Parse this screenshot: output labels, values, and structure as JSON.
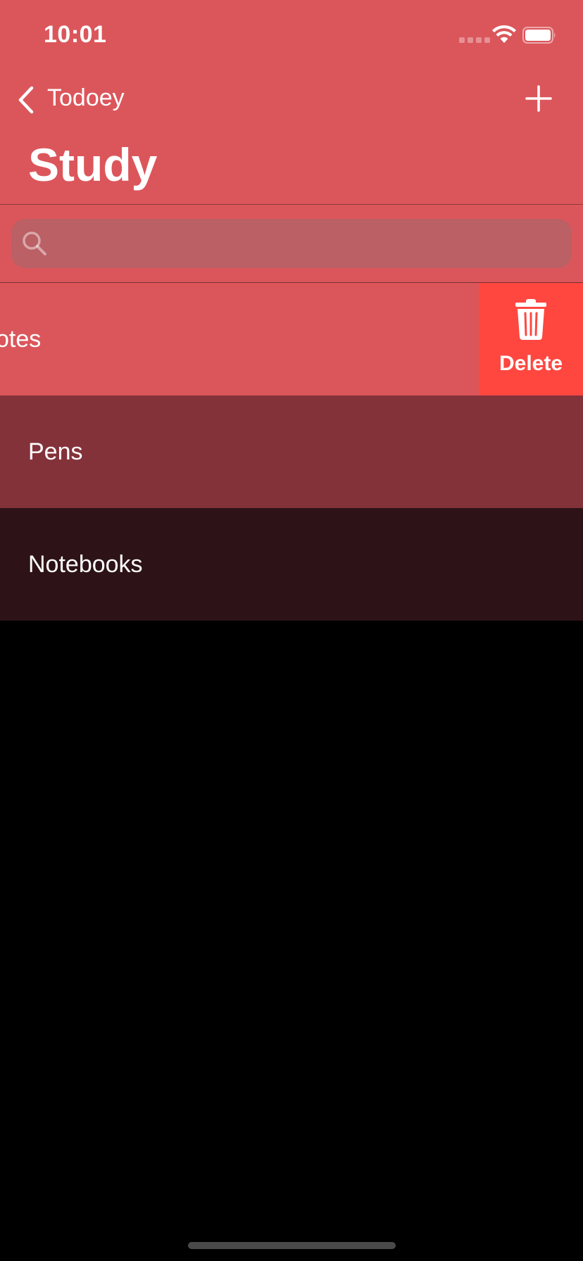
{
  "status_bar": {
    "time": "10:01"
  },
  "nav": {
    "back_label": "Todoey",
    "title": "Study",
    "add_icon": "plus-icon",
    "back_icon": "chevron-left-icon"
  },
  "search": {
    "placeholder": "",
    "value": "",
    "icon": "search-icon"
  },
  "items": [
    {
      "label": "otes",
      "background": "#db565b",
      "swiped": true
    },
    {
      "label": "Pens",
      "background": "#84323a"
    },
    {
      "label": "Notebooks",
      "background": "#2d1317"
    }
  ],
  "swipe_action": {
    "label": "Delete",
    "color": "#ff4740",
    "icon": "trash-icon"
  },
  "colors": {
    "header": "#db565b",
    "search_field": "#bb6065",
    "background": "#000000"
  }
}
